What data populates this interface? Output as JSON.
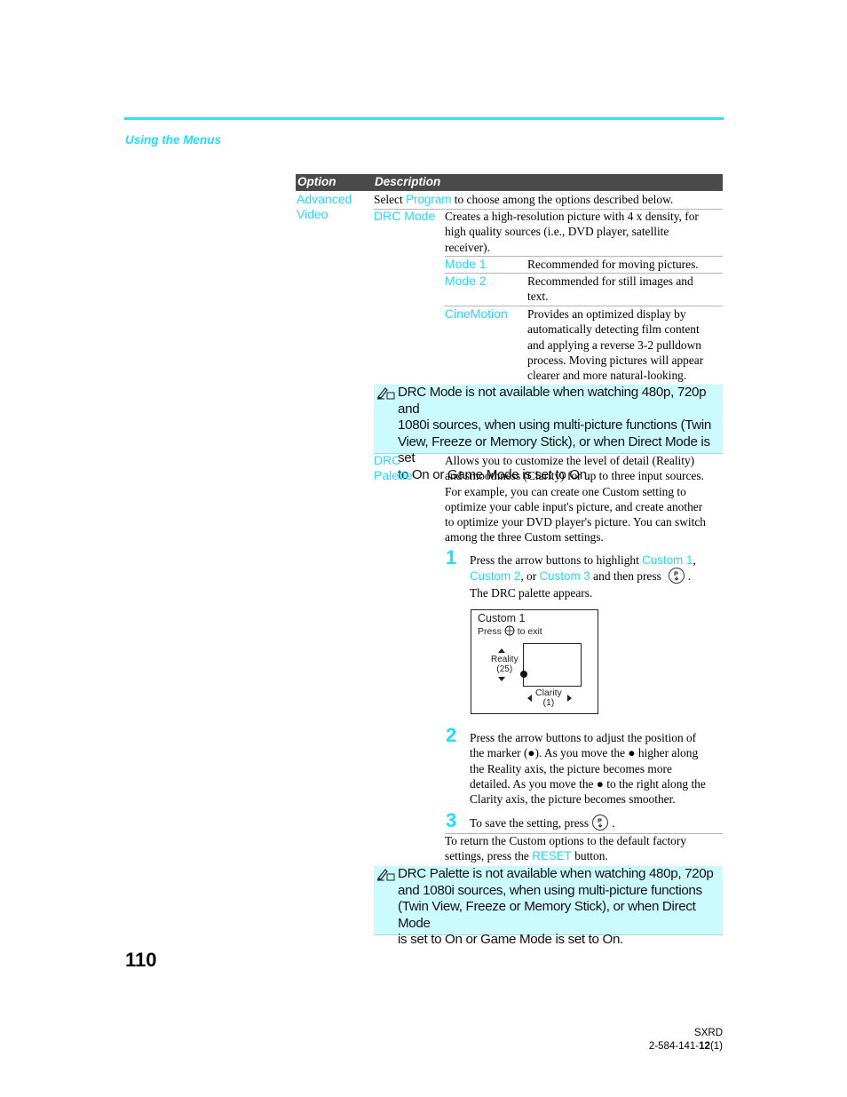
{
  "header": {
    "section_title": "Using the Menus"
  },
  "table": {
    "columns": [
      "Option",
      "Description"
    ],
    "option": {
      "label_line1": "Advanced",
      "label_line2": "Video",
      "intro_pre": "Select ",
      "intro_link": "Program",
      "intro_post": " to choose among the options described below."
    },
    "drc_mode": {
      "label": "DRC Mode",
      "description_lines": [
        "Creates a high-resolution picture with 4 x density, for",
        "high quality sources (i.e., DVD player, satellite",
        "receiver)."
      ],
      "modes": [
        {
          "label": "Mode 1",
          "lines": [
            "Recommended for moving pictures."
          ]
        },
        {
          "label": "Mode 2",
          "lines": [
            "Recommended for still images and",
            "text."
          ]
        },
        {
          "label": "CineMotion",
          "lines": [
            "Provides an optimized display by",
            "automatically detecting film content",
            "and applying a reverse 3-2 pulldown",
            "process. Moving pictures will appear",
            "clearer and more natural-looking."
          ]
        }
      ],
      "note_lines": [
        "DRC Mode is not available when watching 480p, 720p and",
        "1080i sources, when using multi-picture functions (Twin",
        "View, Freeze or Memory Stick), or when Direct Mode is set",
        "to On or Game Mode is set to On."
      ]
    },
    "drc_palette": {
      "label_line1": "DRC",
      "label_line2": "Palette",
      "description_lines": [
        "Allows you to customize the level of detail (Reality)",
        "and smoothness (Clarity) for up to three input sources.",
        "For example, you can create one Custom setting to",
        "optimize your cable input's picture, and create another",
        "to optimize your DVD player's picture. You can switch",
        "among the three Custom settings."
      ],
      "steps": [
        {
          "number": "1",
          "l1_pre": "Press the arrow buttons to highlight ",
          "l1_link": "Custom 1",
          "l1_post": ",",
          "l2_link1": "Custom 2",
          "l2_mid": ", or ",
          "l2_link2": "Custom 3",
          "l2_post": " and then press",
          "l3": "The DRC palette appears."
        },
        {
          "number": "2",
          "lines": [
            "Press the arrow buttons to adjust the position of",
            "the marker (●). As you move the ● higher along",
            "the Reality axis, the picture becomes more",
            "detailed. As you move the ● to the right along the",
            "Clarity axis, the picture becomes smoother."
          ]
        },
        {
          "number": "3",
          "text": "To save the setting, press"
        }
      ],
      "palette": {
        "title": "Custom 1",
        "sub_pre": "Press",
        "sub_post": "to exit",
        "reality_label": "Reality",
        "reality_value": "(25)",
        "clarity_label": "Clarity",
        "clarity_value": "(1)"
      },
      "reset_l1": "To return the Custom options to the default factory",
      "reset_l2_pre": "settings, press the ",
      "reset_link": "RESET",
      "reset_l2_post": " button.",
      "note_lines": [
        "DRC Palette is not available when watching 480p, 720p",
        "and 1080i sources, when using multi-picture functions",
        "(Twin View, Freeze or Memory Stick), or when Direct Mode",
        "is set to On or Game Mode is set to On."
      ]
    }
  },
  "footer": {
    "page_number": "110",
    "model": "SXRD",
    "code_pre": "2-584-141-",
    "code_bold": "12",
    "code_post": "(1)"
  },
  "colors": {
    "accent_cyan": "#22ddff",
    "header_bg": "#4a4a4a",
    "note_bg": "#ccfbff"
  }
}
